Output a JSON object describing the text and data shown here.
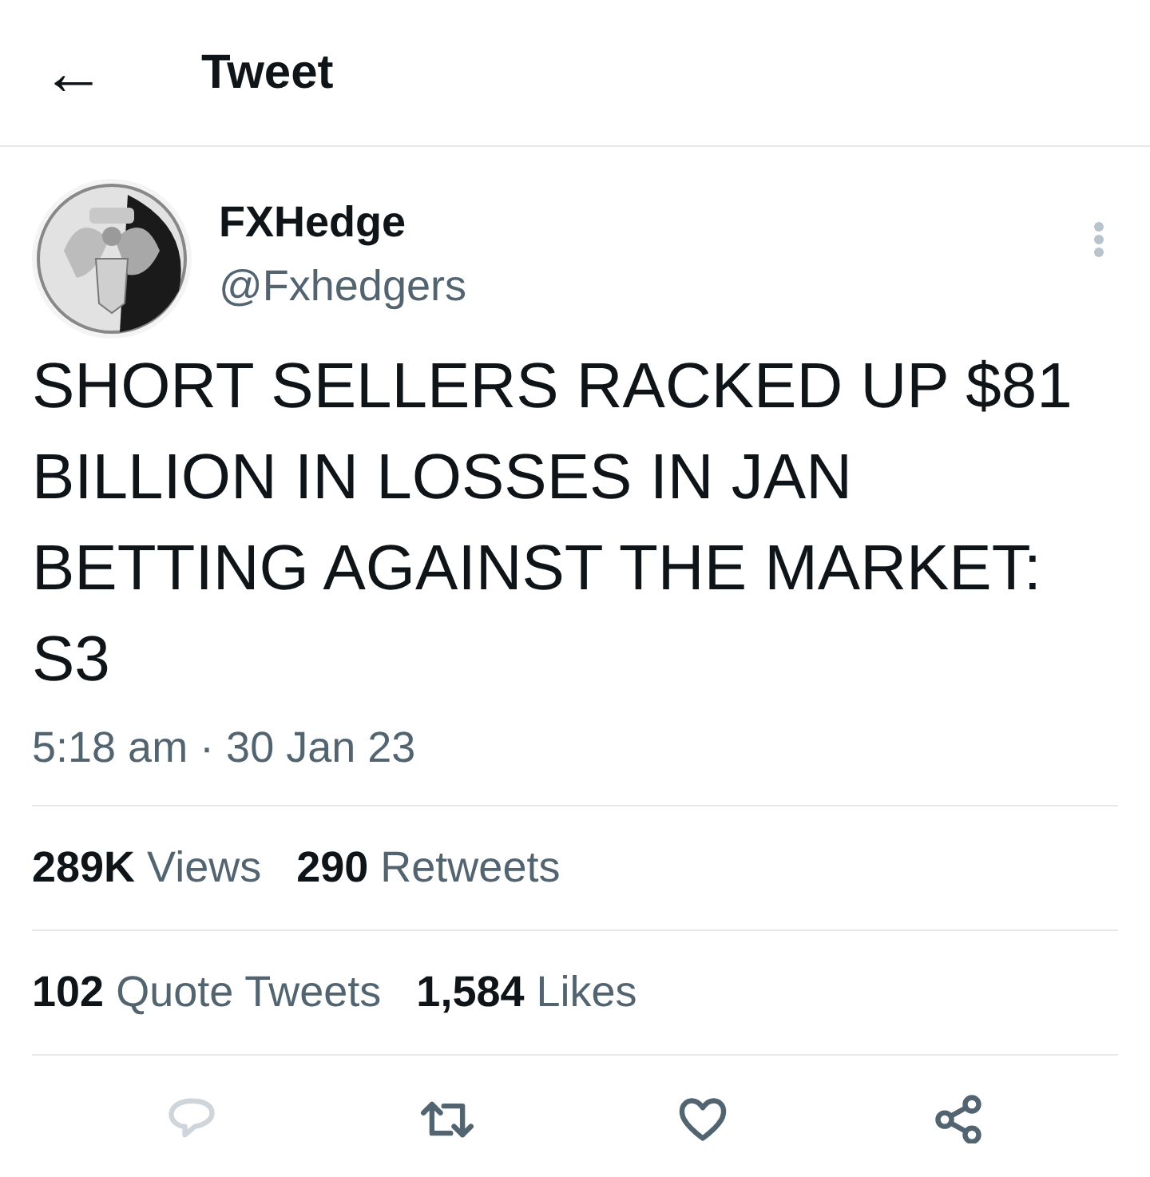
{
  "header": {
    "back": "←",
    "title": "Tweet"
  },
  "tweet": {
    "name": "FXHedge",
    "handle": "@Fxhedgers",
    "text": "SHORT SELLERS RACKED UP $81 BILLION IN LOSSES IN JAN BETTING AGAINST THE MARKET: S3",
    "time": "5:18 am · 30 Jan 23"
  },
  "stats_rows": [
    [
      "**289K** Views",
      "**290** Retweets"
    ],
    [
      "**102** Quote Tweets",
      "**1,584** Likes"
    ]
  ],
  "actions": [
    {
      "kind": "reply",
      "disabled": true
    },
    {
      "kind": "retweet",
      "disabled": false
    },
    {
      "kind": "like",
      "disabled": false
    },
    {
      "kind": "share",
      "disabled": false
    }
  ]
}
